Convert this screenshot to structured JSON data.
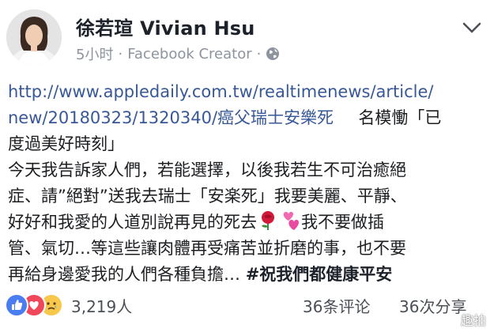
{
  "header": {
    "author": "徐若瑄 Vivian Hsu",
    "time": "5小时",
    "separator": "·",
    "source": "Facebook Creator",
    "separator2": "·"
  },
  "post": {
    "link_line1": "http://www.appledaily.com.tw/realtimenews/article/",
    "link_line2": "new/20180323/1320340/癌父瑞士安樂死",
    "line2_tail": "名模慟「已",
    "line3": "度過美好時刻」",
    "line4": "今天我告訴家人們，若能選擇，以後我若生不可治癒絕",
    "line5": "症、請”絕對”送我去瑞士「安楽死」我要美麗、平靜、",
    "line6_a": "好好和我愛的人道別說再見的死去",
    "line6_b": "我不要做插",
    "line7": "管、氣切…等這些讓肉體再受痛苦並折磨的事，也不要",
    "line8_a": "再給身邊愛我的人們各種負擔…",
    "hashtag": "#祝我們都健康平安"
  },
  "footer": {
    "reaction_count": "3,219人",
    "comments": "36条评论",
    "shares": "36次分享"
  },
  "watermark": {
    "text": "趣拍"
  },
  "icons": {
    "like": "like-reaction-icon",
    "love": "love-reaction-icon",
    "sad": "sad-reaction-icon",
    "globe": "globe-icon",
    "chevron": "chevron-down-icon",
    "rose": "rose-emoji-icon",
    "hearts": "two-hearts-emoji-icon"
  },
  "colors": {
    "link": "#385898",
    "like": "#4a7ef0",
    "love": "#f0485a",
    "sad": "#f7c84b"
  }
}
